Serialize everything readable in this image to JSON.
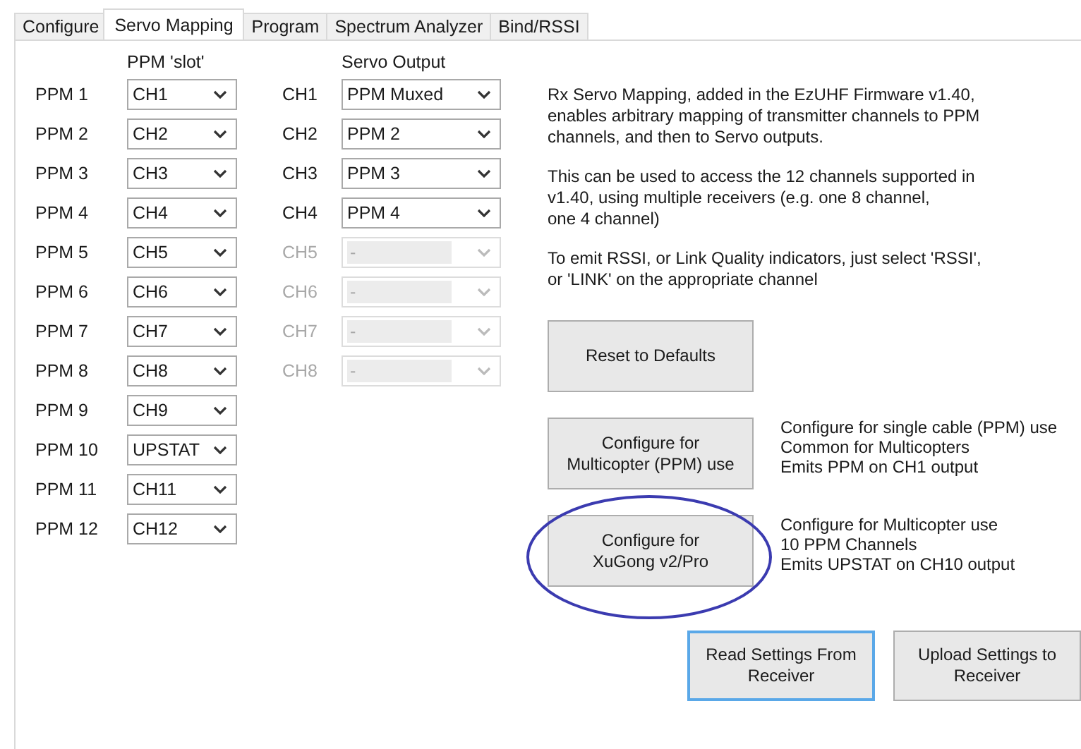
{
  "tabs": [
    {
      "label": "Configure",
      "selected": false
    },
    {
      "label": "Servo Mapping",
      "selected": true
    },
    {
      "label": "Program",
      "selected": false
    },
    {
      "label": "Spectrum Analyzer",
      "selected": false
    },
    {
      "label": "Bind/RSSI",
      "selected": false
    }
  ],
  "headers": {
    "ppm_slot": "PPM 'slot'",
    "servo_output": "Servo Output"
  },
  "rows": [
    {
      "ppm": "PPM 1",
      "slot": "CH1",
      "servo": {
        "channel": "CH1",
        "value": "PPM Muxed",
        "disabled": false
      }
    },
    {
      "ppm": "PPM 2",
      "slot": "CH2",
      "servo": {
        "channel": "CH2",
        "value": "PPM 2",
        "disabled": false
      }
    },
    {
      "ppm": "PPM 3",
      "slot": "CH3",
      "servo": {
        "channel": "CH3",
        "value": "PPM 3",
        "disabled": false
      }
    },
    {
      "ppm": "PPM 4",
      "slot": "CH4",
      "servo": {
        "channel": "CH4",
        "value": "PPM 4",
        "disabled": false
      }
    },
    {
      "ppm": "PPM 5",
      "slot": "CH5",
      "servo": {
        "channel": "CH5",
        "value": "-",
        "disabled": true
      }
    },
    {
      "ppm": "PPM 6",
      "slot": "CH6",
      "servo": {
        "channel": "CH6",
        "value": "-",
        "disabled": true
      }
    },
    {
      "ppm": "PPM 7",
      "slot": "CH7",
      "servo": {
        "channel": "CH7",
        "value": "-",
        "disabled": true
      }
    },
    {
      "ppm": "PPM 8",
      "slot": "CH8",
      "servo": {
        "channel": "CH8",
        "value": "-",
        "disabled": true
      }
    },
    {
      "ppm": "PPM 9",
      "slot": "CH9"
    },
    {
      "ppm": "PPM 10",
      "slot": "UPSTAT"
    },
    {
      "ppm": "PPM 11",
      "slot": "CH11"
    },
    {
      "ppm": "PPM 12",
      "slot": "CH12"
    }
  ],
  "info": [
    "Rx Servo Mapping, added in the EzUHF Firmware v1.40,\nenables arbitrary mapping of transmitter channels to PPM\nchannels, and then to Servo outputs.",
    "This can be used to access the 12 channels supported in\nv1.40, using multiple receivers (e.g. one 8 channel,\none 4 channel)",
    "To emit RSSI, or Link Quality indicators, just select 'RSSI',\nor 'LINK' on the appropriate channel"
  ],
  "reset_button": "Reset to Defaults",
  "presets": [
    {
      "button": "Configure for\nMulticopter (PPM) use",
      "description": "Configure for single cable (PPM) use\nCommon for Multicopters\nEmits PPM on CH1 output",
      "circled": false
    },
    {
      "button": "Configure for\nXuGong v2/Pro",
      "description": "Configure for Multicopter use\n10 PPM Channels\nEmits UPSTAT on CH10 output",
      "circled": true
    }
  ],
  "bottom_buttons": [
    {
      "label": "Read Settings From\nReceiver",
      "focused": true
    },
    {
      "label": "Upload Settings to\nReceiver",
      "focused": false
    }
  ]
}
